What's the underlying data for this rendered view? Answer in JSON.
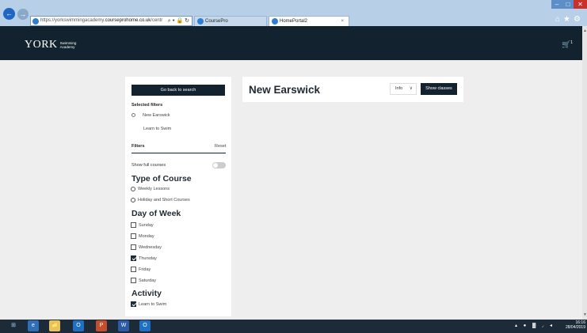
{
  "browser": {
    "url_prefix": "https://yorkswimmingacademy.",
    "url_domain": "courseprohome.co.uk",
    "url_suffix": "/centr",
    "addr_controls": "⌕ ▾ 🔒 ↻",
    "tabs": [
      {
        "label": "CoursePro",
        "active": false
      },
      {
        "label": "HomePortal2",
        "active": true
      }
    ],
    "tab_close": "×",
    "window_controls": {
      "minimize": "–",
      "maximize": "□",
      "close": "✕"
    },
    "toolbar_icons": "⌂★⚙"
  },
  "header": {
    "logo_main": "YORK",
    "logo_sub_1": "Swimming",
    "logo_sub_2": "Academy",
    "cart_icon": "🛒",
    "cart_count": "1"
  },
  "sidebar": {
    "back_button": "Go back to search",
    "selected_filters_title": "Selected filters",
    "selected_filters": [
      "New Earswick",
      "Learn to Swim"
    ],
    "filters_title": "Filters",
    "reset_label": "Reset",
    "show_full_courses_label": "Show full courses",
    "type_of_course": {
      "title": "Type of Course",
      "options": [
        "Weekly Lessons",
        "Holiday and Short Courses"
      ]
    },
    "day_of_week": {
      "title": "Day of Week",
      "options": [
        {
          "label": "Sunday",
          "checked": false
        },
        {
          "label": "Monday",
          "checked": false
        },
        {
          "label": "Wednesday",
          "checked": false
        },
        {
          "label": "Thursday",
          "checked": true
        },
        {
          "label": "Friday",
          "checked": false
        },
        {
          "label": "Saturday",
          "checked": false
        }
      ]
    },
    "activity": {
      "title": "Activity",
      "options": [
        {
          "label": "Learn to Swim",
          "checked": true
        }
      ]
    }
  },
  "main": {
    "title": "New Earswick",
    "info_label": "Info",
    "info_chevron": "∨",
    "show_classes_label": "Show classes"
  },
  "taskbar": {
    "apps": [
      "⊞",
      "e",
      "📁",
      "O",
      "P",
      "W",
      "O"
    ],
    "tray": "▴ ● ▓ ◞ ◂",
    "time": "16:16",
    "date": "28/04/2019"
  },
  "colors": {
    "header_bg": "#12232f",
    "button_bg": "#12232f",
    "page_bg": "#eeeeee",
    "browser_chrome": "#b7cfe7",
    "close_red": "#c9302c"
  }
}
